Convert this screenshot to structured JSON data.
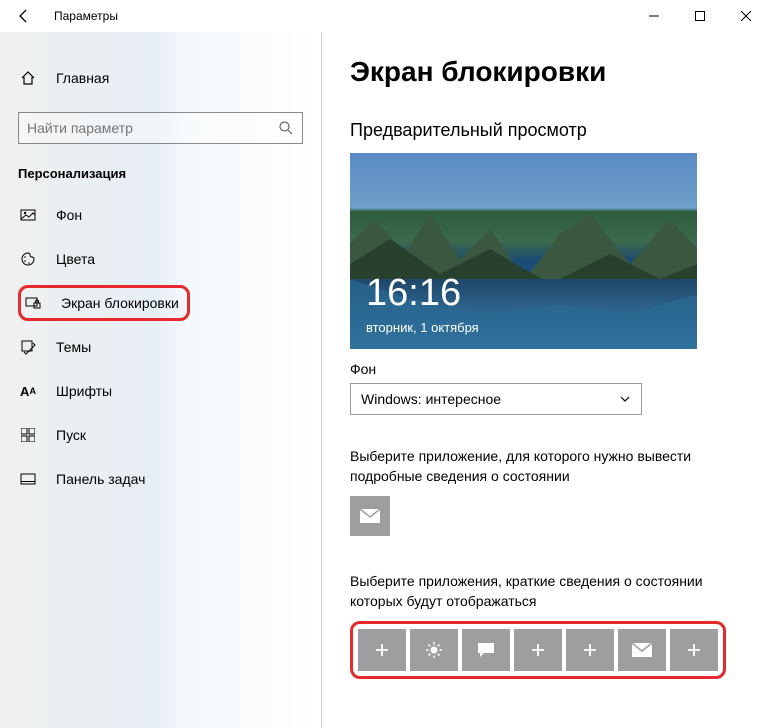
{
  "window": {
    "title": "Параметры"
  },
  "sidebar": {
    "home": "Главная",
    "search_placeholder": "Найти параметр",
    "section": "Персонализация",
    "items": [
      {
        "label": "Фон"
      },
      {
        "label": "Цвета"
      },
      {
        "label": "Экран блокировки"
      },
      {
        "label": "Темы"
      },
      {
        "label": "Шрифты"
      },
      {
        "label": "Пуск"
      },
      {
        "label": "Панель задач"
      }
    ]
  },
  "content": {
    "heading": "Экран блокировки",
    "preview_label": "Предварительный просмотр",
    "preview_time": "16:16",
    "preview_date": "вторник, 1 октября",
    "bg_label": "Фон",
    "bg_value": "Windows: интересное",
    "detailed_app_label": "Выберите приложение, для которого нужно вывести подробные сведения о состоянии",
    "quick_apps_label": "Выберите приложения, краткие сведения о состоянии которых будут отображаться"
  }
}
